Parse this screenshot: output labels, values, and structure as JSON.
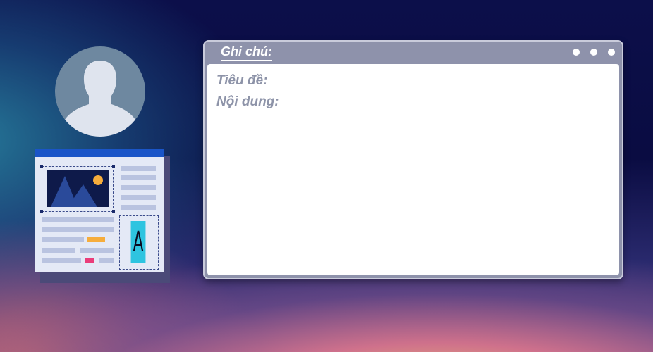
{
  "note": {
    "title": "Ghi chú:",
    "fields": [
      {
        "label": "Tiêu đề:"
      },
      {
        "label": "Nội dung:"
      }
    ]
  },
  "document_illustration": {
    "glyph": "A"
  },
  "colors": {
    "note_frame": "#8e92ab",
    "note_body": "#ffffff",
    "label_text": "#8d93a8",
    "doc_header": "#1a55c8",
    "accent_orange": "#f6ad3c",
    "accent_pink": "#ea3d7a",
    "glyph_box": "#2ec4e0"
  },
  "icons": [
    "user-avatar-icon",
    "image-placeholder-icon",
    "window-control-dots"
  ]
}
